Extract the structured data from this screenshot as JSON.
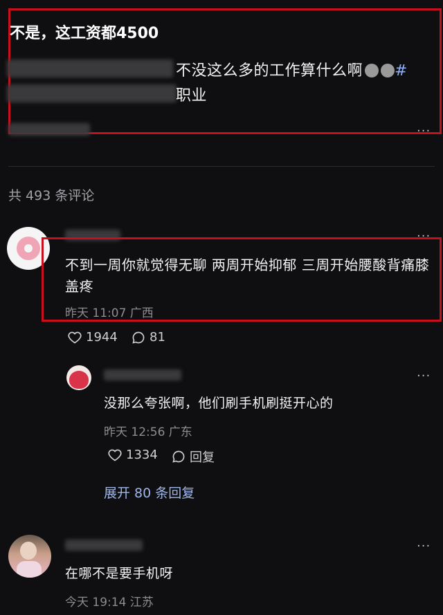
{
  "post": {
    "title": "不是，这工资都4500",
    "body_line1_visible": "不没这么多的工作算什么啊",
    "hashtag": "#",
    "body_line2_visible": "职业",
    "more": "..."
  },
  "comments_header": "共 493 条评论",
  "comment1": {
    "text": "不到一周你就觉得无聊 两周开始抑郁 三周开始腰酸背痛膝盖疼",
    "meta": "昨天 11:07 广西",
    "likes": "1944",
    "replies": "81",
    "more": "..."
  },
  "reply1": {
    "text": "没那么夸张啊，他们刷手机刷挺开心的",
    "meta": "昨天 12:56 广东",
    "likes": "1334",
    "reply_label": "回复",
    "more": "..."
  },
  "expand_replies": "展开 80 条回复",
  "comment2": {
    "text": "在哪不是要手机呀",
    "meta": "今天 19:14 江苏",
    "more": "..."
  }
}
